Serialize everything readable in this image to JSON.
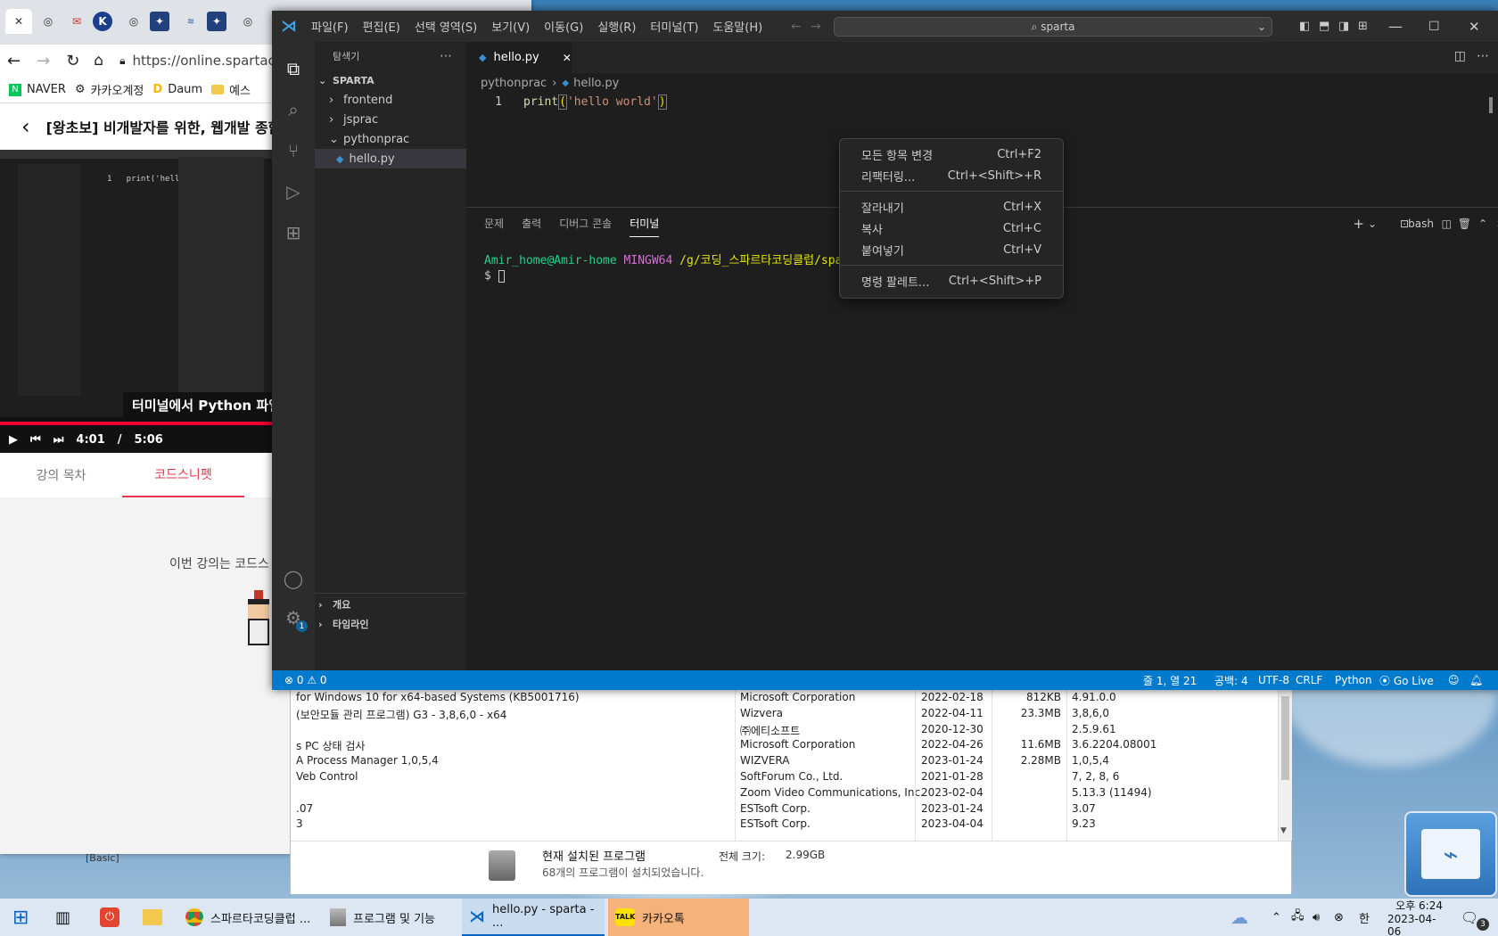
{
  "browser": {
    "tab_icons": [
      "close-icon",
      "chrome-tab-icon",
      "gmail-icon",
      "k-icon",
      "chrome-tab-icon",
      "sparta-icon",
      "sparta-icon",
      "sparta-icon",
      "chrome-tab-icon"
    ],
    "url": "https://online.spartac",
    "bookmarks": [
      "NAVER",
      "카카오계정",
      "Daum",
      "예스"
    ],
    "lecture_title": "[왕초보] 비개발자를 위한, 웹개발 종합반",
    "video_caption": "터미널에서 Python 파일",
    "time_current": "4:01",
    "time_sep": "/",
    "time_total": "5:06",
    "lecture_tabs": [
      "강의 목차",
      "코드스니펫"
    ],
    "snippet_notice": "이번 강의는 코드스",
    "watermark": "[Basic]",
    "video_progress": 0.6
  },
  "programs": {
    "rows": [
      {
        "name": "for Windows 10 for x64-based Systems (KB5001716)",
        "publisher": "Microsoft Corporation",
        "date": "2022-02-18",
        "size": "812KB",
        "version": "4.91.0.0"
      },
      {
        "name": "(보안모듈 관리 프로그램) G3 - 3,8,6,0 - x64",
        "publisher": "Wizvera",
        "date": "2022-04-11",
        "size": "23.3MB",
        "version": "3,8,6,0"
      },
      {
        "name": "",
        "publisher": "㈜에티소프트",
        "date": "2020-12-30",
        "size": "",
        "version": "2.5.9.61"
      },
      {
        "name": "s PC 상태 검사",
        "publisher": "Microsoft Corporation",
        "date": "2022-04-26",
        "size": "11.6MB",
        "version": "3.6.2204.08001"
      },
      {
        "name": "A Process Manager 1,0,5,4",
        "publisher": "WIZVERA",
        "date": "2023-01-24",
        "size": "2.28MB",
        "version": "1,0,5,4"
      },
      {
        "name": "Veb Control",
        "publisher": "SoftForum Co., Ltd.",
        "date": "2021-01-28",
        "size": "",
        "version": "7, 2, 8, 6"
      },
      {
        "name": "",
        "publisher": "Zoom Video Communications, Inc.",
        "date": "2023-02-04",
        "size": "",
        "version": "5.13.3 (11494)"
      },
      {
        "name": ".07",
        "publisher": "ESTsoft Corp.",
        "date": "2023-01-24",
        "size": "",
        "version": "3.07"
      },
      {
        "name": "3",
        "publisher": "ESTsoft Corp.",
        "date": "2023-04-04",
        "size": "",
        "version": "9.23"
      }
    ],
    "footer_title": "현재 설치된 프로그램",
    "footer_total_label": "전체 크기:",
    "footer_total": "2.99GB",
    "footer_count": "68개의 프로그램이 설치되었습니다."
  },
  "vscode": {
    "menu": [
      "파일(F)",
      "편집(E)",
      "선택 영역(S)",
      "보기(V)",
      "이동(G)",
      "실행(R)",
      "터미널(T)",
      "도움말(H)"
    ],
    "search": "sparta",
    "explorer_title": "탐색기",
    "workspace": "SPARTA",
    "tree": [
      {
        "label": "frontend",
        "type": "folder",
        "open": false
      },
      {
        "label": "jsprac",
        "type": "folder",
        "open": false
      },
      {
        "label": "pythonprac",
        "type": "folder",
        "open": true
      },
      {
        "label": "hello.py",
        "type": "file",
        "selected": true
      }
    ],
    "outline": "개요",
    "timeline": "타임라인",
    "tab_file": "hello.py",
    "breadcrumb_folder": "pythonprac",
    "breadcrumb_file": "hello.py",
    "line_no": "1",
    "code_fn": "print",
    "code_open": "(",
    "code_str": "'hello world'",
    "code_close": ")",
    "panel_tabs": [
      "문제",
      "출력",
      "디버그 콘솔",
      "터미널"
    ],
    "shell": "bash",
    "term_user": "Amir_home@Amir-home",
    "term_env": "MINGW64",
    "term_path": "/g/코딩_스파르타코딩클럽/spar",
    "term_prompt": "$",
    "status": {
      "problems": "0",
      "warnings": "0",
      "position": "줄 1, 열 21",
      "spaces": "공백: 4",
      "encoding": "UTF-8",
      "eol": "CRLF",
      "language": "Python",
      "golive": "Go Live"
    },
    "settings_badge": "1",
    "context_menu": [
      {
        "label": "모든 항목 변경",
        "shortcut": "Ctrl+F2"
      },
      {
        "label": "리팩터링...",
        "shortcut": "Ctrl+<Shift>+R"
      },
      {
        "label": "잘라내기",
        "shortcut": "Ctrl+X"
      },
      {
        "label": "복사",
        "shortcut": "Ctrl+C"
      },
      {
        "label": "붙여넣기",
        "shortcut": "Ctrl+V"
      },
      {
        "label": "명령 팔레트...",
        "shortcut": "Ctrl+<Shift>+P"
      }
    ]
  },
  "taskbar": {
    "apps": [
      {
        "label": "스파르타코딩클럽 ..."
      },
      {
        "label": "프로그램 및 기능"
      },
      {
        "label": "hello.py - sparta - ..."
      },
      {
        "label": "카카오톡"
      }
    ],
    "ime": "한",
    "time": "오후 6:24",
    "date": "2023-04-06",
    "notif_count": "3"
  },
  "colors": {
    "statusbar": "#007acc",
    "accent_red": "#e8344e",
    "term_green": "#23d18b",
    "term_magenta": "#d670d6",
    "term_yellow": "#e5e510"
  }
}
